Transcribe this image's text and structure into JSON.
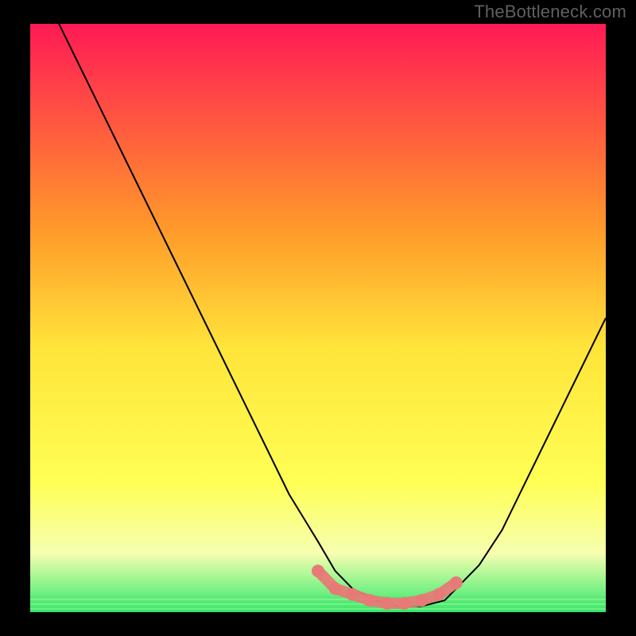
{
  "watermark": "TheBottleneck.com",
  "colors": {
    "black": "#000000",
    "grad_top": "#ff1a55",
    "grad_mid1": "#ff9a2a",
    "grad_mid2": "#ffe43a",
    "grad_yellow": "#ffff55",
    "grad_pale": "#f6ffb0",
    "grad_green": "#2fe86a",
    "curve": "#000000",
    "markers": "#e77a76"
  },
  "chart_data": {
    "type": "line",
    "title": "",
    "xlabel": "",
    "ylabel": "",
    "xlim": [
      0,
      100
    ],
    "ylim": [
      0,
      100
    ],
    "series": [
      {
        "name": "bottleneck-curve",
        "x": [
          5,
          10,
          15,
          20,
          25,
          30,
          35,
          40,
          45,
          50,
          53,
          56,
          60,
          64,
          68,
          72,
          74,
          78,
          82,
          86,
          90,
          95,
          100
        ],
        "y": [
          100,
          90,
          80,
          70,
          60,
          50,
          40,
          30,
          20,
          12,
          7,
          4,
          2,
          1,
          1,
          2,
          4,
          8,
          14,
          22,
          30,
          40,
          50
        ]
      }
    ],
    "markers": {
      "name": "highlight-points",
      "x": [
        50,
        53,
        56,
        59,
        62,
        65,
        68,
        71,
        74
      ],
      "y": [
        7,
        4,
        3,
        2,
        1.5,
        1.5,
        2,
        3,
        5
      ]
    }
  }
}
